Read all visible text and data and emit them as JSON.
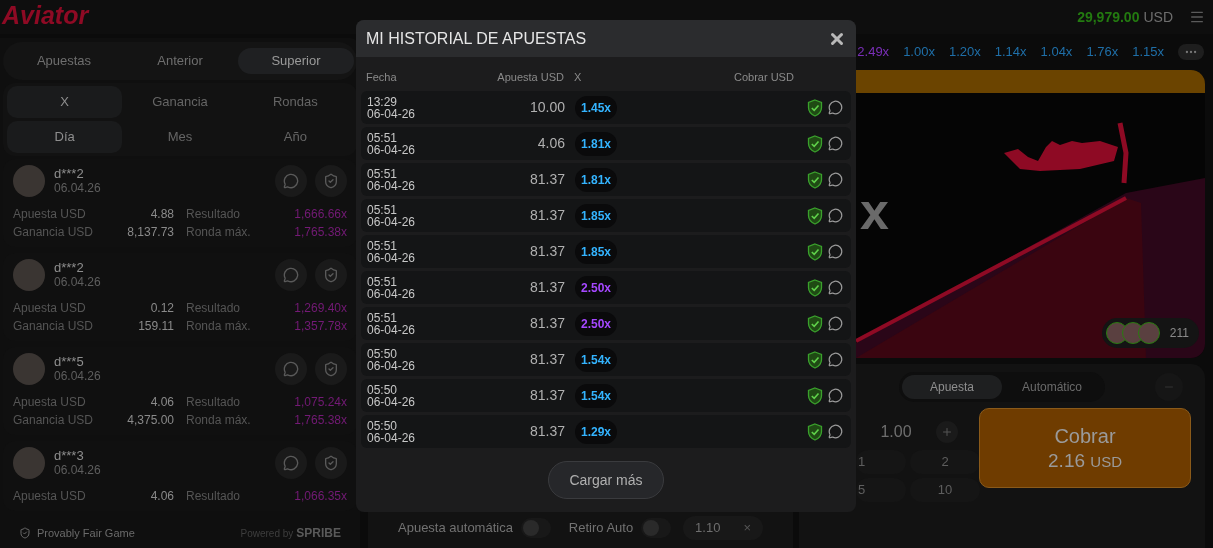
{
  "header": {
    "logo": "Aviator",
    "balance": "29,979.00",
    "currency": "USD"
  },
  "left_panel": {
    "tabs": [
      {
        "label": "Apuestas",
        "selected": false
      },
      {
        "label": "Anterior",
        "selected": false
      },
      {
        "label": "Superior",
        "selected": true
      }
    ],
    "sort_tabs": [
      {
        "label": "X",
        "selected": true
      },
      {
        "label": "Ganancia",
        "selected": false
      },
      {
        "label": "Rondas",
        "selected": false
      }
    ],
    "period_tabs": [
      {
        "label": "Día",
        "selected": true
      },
      {
        "label": "Mes",
        "selected": false
      },
      {
        "label": "Año",
        "selected": false
      }
    ],
    "cards": [
      {
        "user": "d***2",
        "date": "06.04.26",
        "stats": [
          {
            "label": "Apuesta USD",
            "value": "4.88",
            "kind": "amount"
          },
          {
            "label": "Resultado",
            "value": "1,666.66x",
            "kind": "multiplier"
          },
          {
            "label": "Ganancia USD",
            "value": "8,137.73",
            "kind": "amount"
          },
          {
            "label": "Ronda máx.",
            "value": "1,765.38x",
            "kind": "multiplier"
          }
        ]
      },
      {
        "user": "d***2",
        "date": "06.04.26",
        "stats": [
          {
            "label": "Apuesta USD",
            "value": "0.12",
            "kind": "amount"
          },
          {
            "label": "Resultado",
            "value": "1,269.40x",
            "kind": "multiplier"
          },
          {
            "label": "Ganancia USD",
            "value": "159.11",
            "kind": "amount"
          },
          {
            "label": "Ronda máx.",
            "value": "1,357.78x",
            "kind": "multiplier"
          }
        ]
      },
      {
        "user": "d***5",
        "date": "06.04.26",
        "stats": [
          {
            "label": "Apuesta USD",
            "value": "4.06",
            "kind": "amount"
          },
          {
            "label": "Resultado",
            "value": "1,075.24x",
            "kind": "multiplier"
          },
          {
            "label": "Ganancia USD",
            "value": "4,375.00",
            "kind": "amount"
          },
          {
            "label": "Ronda máx.",
            "value": "1,765.38x",
            "kind": "multiplier"
          }
        ]
      },
      {
        "user": "d***3",
        "date": "06.04.26",
        "stats": [
          {
            "label": "Apuesta USD",
            "value": "4.06",
            "kind": "amount"
          },
          {
            "label": "Resultado",
            "value": "1,066.35x",
            "kind": "multiplier"
          }
        ]
      }
    ],
    "footer": {
      "fair": "Provably Fair Game",
      "powered": "Powered by",
      "brand": "SPRIBE"
    }
  },
  "history_strip": [
    {
      "value": "2.49x",
      "color": "#7a2fb8"
    },
    {
      "value": "1.00x",
      "color": "#1f6fa8"
    },
    {
      "value": "1.20x",
      "color": "#1f6fa8"
    },
    {
      "value": "1.14x",
      "color": "#1f6fa8"
    },
    {
      "value": "1.04x",
      "color": "#1f6fa8"
    },
    {
      "value": "1.76x",
      "color": "#1f6fa8"
    },
    {
      "value": "1.15x",
      "color": "#1f6fa8"
    }
  ],
  "game": {
    "multiplier": "x",
    "players": "211"
  },
  "auto_bar": {
    "auto_bet": "Apuesta automática",
    "auto_bet_on": false,
    "auto_cashout": "Retiro Auto",
    "auto_cashout_on": false,
    "cashout_value": "1.10",
    "clear": "×"
  },
  "bet_panel": {
    "tabs": [
      {
        "label": "Apuesta",
        "selected": true
      },
      {
        "label": "Automático",
        "selected": false
      }
    ],
    "amount": "1.00",
    "quick": [
      "1",
      "2",
      "5",
      "10"
    ],
    "cashout": {
      "label": "Cobrar",
      "amount": "2.16",
      "currency": "USD"
    }
  },
  "modal": {
    "title": "MI HISTORIAL DE APUESTAS",
    "columns": [
      "Fecha",
      "Apuesta USD",
      "X",
      "Cobrar USD"
    ],
    "rows": [
      {
        "time": "13:29",
        "date": "06-04-26",
        "bet": "10.00",
        "multiplier": "1.45x",
        "color": "#34b4ff"
      },
      {
        "time": "05:51",
        "date": "06-04-26",
        "bet": "4.06",
        "multiplier": "1.81x",
        "color": "#34b4ff"
      },
      {
        "time": "05:51",
        "date": "06-04-26",
        "bet": "81.37",
        "multiplier": "1.81x",
        "color": "#34b4ff"
      },
      {
        "time": "05:51",
        "date": "06-04-26",
        "bet": "81.37",
        "multiplier": "1.85x",
        "color": "#34b4ff"
      },
      {
        "time": "05:51",
        "date": "06-04-26",
        "bet": "81.37",
        "multiplier": "1.85x",
        "color": "#34b4ff"
      },
      {
        "time": "05:51",
        "date": "06-04-26",
        "bet": "81.37",
        "multiplier": "2.50x",
        "color": "#a548ff"
      },
      {
        "time": "05:51",
        "date": "06-04-26",
        "bet": "81.37",
        "multiplier": "2.50x",
        "color": "#a548ff"
      },
      {
        "time": "05:50",
        "date": "06-04-26",
        "bet": "81.37",
        "multiplier": "1.54x",
        "color": "#34b4ff"
      },
      {
        "time": "05:50",
        "date": "06-04-26",
        "bet": "81.37",
        "multiplier": "1.54x",
        "color": "#34b4ff"
      },
      {
        "time": "05:50",
        "date": "06-04-26",
        "bet": "81.37",
        "multiplier": "1.29x",
        "color": "#34b4ff"
      }
    ],
    "load_more": "Cargar más"
  }
}
